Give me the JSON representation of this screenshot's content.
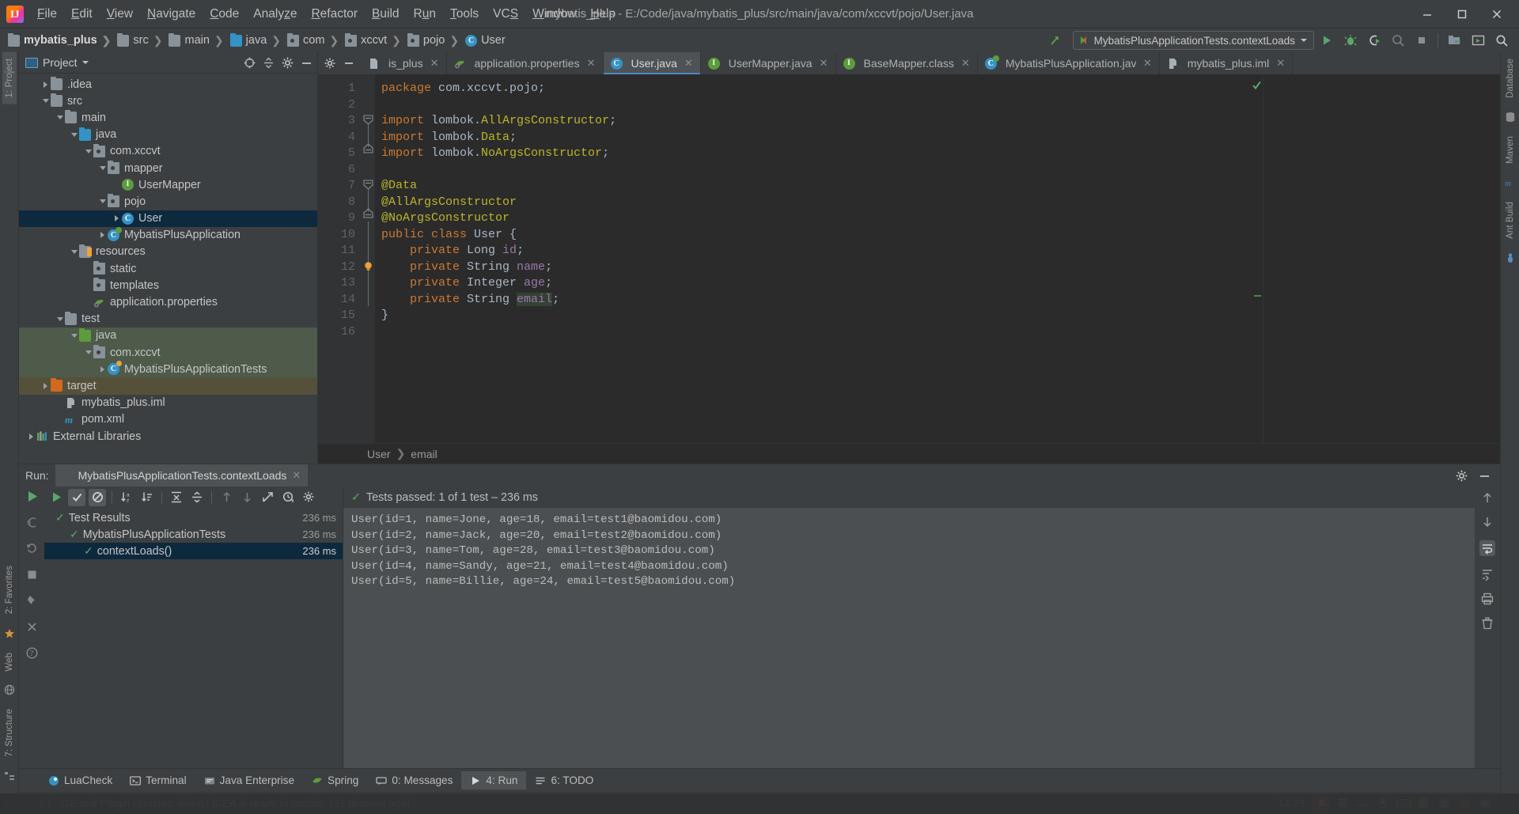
{
  "window": {
    "title": "mybatis_plus - E:/Code/java/mybatis_plus/src/main/java/com/xccvt/pojo/User.java",
    "app_icon": "intellij-idea-logo",
    "minimize": "minimize-icon",
    "maximize": "maximize-icon",
    "close": "close-icon"
  },
  "menubar": {
    "items": [
      {
        "label": "File"
      },
      {
        "label": "Edit"
      },
      {
        "label": "View"
      },
      {
        "label": "Navigate"
      },
      {
        "label": "Code"
      },
      {
        "label": "Analyze"
      },
      {
        "label": "Refactor"
      },
      {
        "label": "Build"
      },
      {
        "label": "Run"
      },
      {
        "label": "Tools"
      },
      {
        "label": "VCS"
      },
      {
        "label": "Window"
      },
      {
        "label": "Help"
      }
    ]
  },
  "navbar": {
    "breadcrumbs": [
      {
        "label": "mybatis_plus",
        "icon": "module-folder-icon"
      },
      {
        "label": "src",
        "icon": "folder-icon"
      },
      {
        "label": "main",
        "icon": "folder-icon"
      },
      {
        "label": "java",
        "icon": "source-folder-icon"
      },
      {
        "label": "com",
        "icon": "package-icon"
      },
      {
        "label": "xccvt",
        "icon": "package-icon"
      },
      {
        "label": "pojo",
        "icon": "package-icon"
      },
      {
        "label": "User",
        "icon": "class-icon"
      }
    ],
    "run_config": "MybatisPlusApplicationTests.contextLoads",
    "buttons": [
      {
        "name": "run-button",
        "icon": "play-icon"
      },
      {
        "name": "debug-button",
        "icon": "bug-icon"
      },
      {
        "name": "run-with-coverage-button",
        "icon": "coverage-icon"
      },
      {
        "name": "profile-button",
        "icon": "profiler-icon"
      },
      {
        "name": "stop-button",
        "icon": "stop-icon"
      },
      {
        "name": "project-structure-button",
        "icon": "project-structure-icon"
      },
      {
        "name": "updates-button",
        "icon": "terminal-window-icon"
      },
      {
        "name": "search-everywhere-button",
        "icon": "search-icon"
      }
    ]
  },
  "left_strip": {
    "items": [
      {
        "label": "1: Project",
        "selected": true
      },
      {
        "label": "2: Favorites",
        "selected": false
      },
      {
        "label": "Web",
        "selected": false
      },
      {
        "label": "7: Structure",
        "selected": false
      }
    ],
    "more": "»"
  },
  "right_strip": {
    "items": [
      {
        "label": "Database"
      },
      {
        "label": "Maven"
      },
      {
        "label": "Ant Build"
      }
    ]
  },
  "project_panel": {
    "title": "Project",
    "actions": [
      {
        "name": "scroll-from-source-icon"
      },
      {
        "name": "collapse-all-icon"
      },
      {
        "name": "settings-gear-icon"
      },
      {
        "name": "hide-panel-icon"
      }
    ],
    "tree": [
      {
        "label": ".idea",
        "indent": 1,
        "arrow": "right",
        "icon": "folder-icon",
        "state": "normal"
      },
      {
        "label": "src",
        "indent": 1,
        "arrow": "down",
        "icon": "folder-icon",
        "state": "normal"
      },
      {
        "label": "main",
        "indent": 2,
        "arrow": "down",
        "icon": "folder-icon",
        "state": "normal"
      },
      {
        "label": "java",
        "indent": 3,
        "arrow": "down",
        "icon": "source-folder-icon",
        "state": "normal"
      },
      {
        "label": "com.xccvt",
        "indent": 4,
        "arrow": "down",
        "icon": "package-icon",
        "state": "normal"
      },
      {
        "label": "mapper",
        "indent": 5,
        "arrow": "down",
        "icon": "package-icon",
        "state": "normal"
      },
      {
        "label": "UserMapper",
        "indent": 6,
        "arrow": "none",
        "icon": "interface-icon",
        "state": "normal"
      },
      {
        "label": "pojo",
        "indent": 5,
        "arrow": "down",
        "icon": "package-icon",
        "state": "normal"
      },
      {
        "label": "User",
        "indent": 6,
        "arrow": "right",
        "icon": "class-icon",
        "state": "selected"
      },
      {
        "label": "MybatisPlusApplication",
        "indent": 5,
        "arrow": "right",
        "icon": "spring-class-icon",
        "state": "normal"
      },
      {
        "label": "resources",
        "indent": 3,
        "arrow": "down",
        "icon": "resources-folder-icon",
        "state": "normal"
      },
      {
        "label": "static",
        "indent": 4,
        "arrow": "none",
        "icon": "package-icon",
        "state": "normal"
      },
      {
        "label": "templates",
        "indent": 4,
        "arrow": "none",
        "icon": "package-icon",
        "state": "normal"
      },
      {
        "label": "application.properties",
        "indent": 4,
        "arrow": "none",
        "icon": "spring-properties-icon",
        "state": "normal"
      },
      {
        "label": "test",
        "indent": 2,
        "arrow": "down",
        "icon": "folder-icon",
        "state": "normal"
      },
      {
        "label": "java",
        "indent": 3,
        "arrow": "down",
        "icon": "test-source-folder-icon",
        "state": "test"
      },
      {
        "label": "com.xccvt",
        "indent": 4,
        "arrow": "down",
        "icon": "package-icon",
        "state": "test"
      },
      {
        "label": "MybatisPlusApplicationTests",
        "indent": 5,
        "arrow": "right",
        "icon": "spring-test-class-icon",
        "state": "test"
      },
      {
        "label": "target",
        "indent": 1,
        "arrow": "right",
        "icon": "excluded-folder-icon",
        "state": "excluded"
      },
      {
        "label": "mybatis_plus.iml",
        "indent": 2,
        "arrow": "none",
        "icon": "iml-file-icon",
        "state": "normal"
      },
      {
        "label": "pom.xml",
        "indent": 2,
        "arrow": "none",
        "icon": "maven-file-icon",
        "state": "normal"
      },
      {
        "label": "External Libraries",
        "indent": 0,
        "arrow": "right",
        "icon": "libraries-icon",
        "state": "normal"
      }
    ]
  },
  "editor": {
    "tabs": [
      {
        "label": "is_plus",
        "icon": "file-icon",
        "active": false,
        "clipped": true
      },
      {
        "label": "application.properties",
        "icon": "spring-properties-icon",
        "active": false,
        "clipped": false
      },
      {
        "label": "User.java",
        "icon": "class-icon",
        "active": true,
        "clipped": false
      },
      {
        "label": "UserMapper.java",
        "icon": "interface-icon",
        "active": false,
        "clipped": false
      },
      {
        "label": "BaseMapper.class",
        "icon": "interface-icon",
        "active": false,
        "clipped": false
      },
      {
        "label": "MybatisPlusApplication.java",
        "icon": "spring-class-icon",
        "active": false,
        "clipped": false
      },
      {
        "label": "mybatis_plus.iml",
        "icon": "iml-file-icon",
        "active": false,
        "clipped": false
      }
    ],
    "tab_actions": [
      {
        "name": "settings-gear-icon"
      },
      {
        "name": "hide-editor-icon"
      }
    ],
    "line_numbers": [
      "1",
      "2",
      "3",
      "4",
      "5",
      "6",
      "7",
      "8",
      "9",
      "10",
      "11",
      "12",
      "13",
      "14",
      "15",
      "16"
    ],
    "lines": [
      {
        "n": 1,
        "tokens": [
          {
            "t": "package ",
            "c": "k"
          },
          {
            "t": "com.xccvt.pojo;",
            "c": "p"
          }
        ]
      },
      {
        "n": 2,
        "tokens": []
      },
      {
        "n": 3,
        "tokens": [
          {
            "t": "import ",
            "c": "k"
          },
          {
            "t": "lombok.",
            "c": "p"
          },
          {
            "t": "AllArgsConstructor",
            "c": "an"
          },
          {
            "t": ";",
            "c": "p"
          }
        ]
      },
      {
        "n": 4,
        "tokens": [
          {
            "t": "import ",
            "c": "k"
          },
          {
            "t": "lombok.",
            "c": "p"
          },
          {
            "t": "Data",
            "c": "an"
          },
          {
            "t": ";",
            "c": "p"
          }
        ]
      },
      {
        "n": 5,
        "tokens": [
          {
            "t": "import ",
            "c": "k"
          },
          {
            "t": "lombok.",
            "c": "p"
          },
          {
            "t": "NoArgsConstructor",
            "c": "an"
          },
          {
            "t": ";",
            "c": "p"
          }
        ]
      },
      {
        "n": 6,
        "tokens": []
      },
      {
        "n": 7,
        "tokens": [
          {
            "t": "@Data",
            "c": "an"
          }
        ]
      },
      {
        "n": 8,
        "tokens": [
          {
            "t": "@AllArgsConstructor",
            "c": "an"
          }
        ]
      },
      {
        "n": 9,
        "tokens": [
          {
            "t": "@NoArgsConstructor",
            "c": "an"
          }
        ]
      },
      {
        "n": 10,
        "tokens": [
          {
            "t": "public class ",
            "c": "k"
          },
          {
            "t": "User ",
            "c": "p"
          },
          {
            "t": "{",
            "c": "p"
          }
        ]
      },
      {
        "n": 11,
        "tokens": [
          {
            "t": "    ",
            "c": "p"
          },
          {
            "t": "private ",
            "c": "k"
          },
          {
            "t": "Long ",
            "c": "p"
          },
          {
            "t": "id",
            "c": "fld"
          },
          {
            "t": ";",
            "c": "p"
          }
        ]
      },
      {
        "n": 12,
        "tokens": [
          {
            "t": "    ",
            "c": "p"
          },
          {
            "t": "private ",
            "c": "k"
          },
          {
            "t": "String ",
            "c": "p"
          },
          {
            "t": "name",
            "c": "fld"
          },
          {
            "t": ";",
            "c": "p"
          }
        ]
      },
      {
        "n": 13,
        "tokens": [
          {
            "t": "    ",
            "c": "p"
          },
          {
            "t": "private ",
            "c": "k"
          },
          {
            "t": "Integer ",
            "c": "p"
          },
          {
            "t": "age",
            "c": "fld"
          },
          {
            "t": ";",
            "c": "p"
          }
        ]
      },
      {
        "n": 14,
        "tokens": [
          {
            "t": "    ",
            "c": "p"
          },
          {
            "t": "private ",
            "c": "k"
          },
          {
            "t": "String ",
            "c": "p"
          },
          {
            "t": "email",
            "c": "fld-hl"
          },
          {
            "t": ";",
            "c": "p"
          }
        ]
      },
      {
        "n": 15,
        "tokens": [
          {
            "t": "}",
            "c": "p"
          }
        ]
      },
      {
        "n": 16,
        "tokens": []
      }
    ],
    "intention_bulb_line": 13,
    "breadcrumb": [
      {
        "label": "User"
      },
      {
        "label": "email"
      }
    ],
    "inspection_status": "no-errors-checkmark"
  },
  "run_panel": {
    "label": "Run:",
    "tab_title": "MybatisPlusApplicationTests.contextLoads",
    "header_actions": [
      {
        "name": "settings-gear-icon"
      },
      {
        "name": "hide-panel-icon"
      }
    ],
    "toolbar": [
      {
        "name": "rerun-button",
        "icon": "play-icon",
        "state": "normal"
      },
      {
        "name": "show-passed-toggle",
        "icon": "checkmark-icon",
        "state": "on"
      },
      {
        "name": "show-ignored-toggle",
        "icon": "ignored-icon",
        "state": "on"
      },
      {
        "name": "sort-alphabetically",
        "icon": "sort-alpha-icon",
        "state": "normal"
      },
      {
        "name": "sort-by-duration",
        "icon": "sort-duration-icon",
        "state": "normal"
      },
      {
        "name": "expand-all",
        "icon": "expand-all-icon",
        "state": "normal"
      },
      {
        "name": "collapse-all",
        "icon": "collapse-all-icon",
        "state": "normal"
      },
      {
        "name": "previous-failed-test",
        "icon": "arrow-up-icon",
        "state": "dim"
      },
      {
        "name": "next-failed-test",
        "icon": "arrow-down-icon",
        "state": "dim"
      },
      {
        "name": "export-test-results",
        "icon": "export-icon",
        "state": "normal"
      },
      {
        "name": "test-history",
        "icon": "history-clock-icon",
        "state": "normal"
      },
      {
        "name": "test-settings",
        "icon": "settings-gear-icon",
        "state": "normal"
      }
    ],
    "side_icons": [
      {
        "name": "rerun-tests-icon"
      },
      {
        "name": "debug-icon"
      },
      {
        "name": "rerun-failed-icon"
      },
      {
        "name": "stop-icon"
      },
      {
        "name": "pin-tab-icon"
      },
      {
        "name": "close-tab-icon"
      },
      {
        "name": "help-icon"
      }
    ],
    "tree": [
      {
        "label": "Test Results",
        "indent": 0,
        "arrow": "down",
        "duration": "236 ms",
        "selected": false
      },
      {
        "label": "MybatisPlusApplicationTests",
        "indent": 1,
        "arrow": "down",
        "duration": "236 ms",
        "selected": false
      },
      {
        "label": "contextLoads()",
        "indent": 2,
        "arrow": "none",
        "duration": "236 ms",
        "selected": true
      }
    ],
    "status": "Tests passed: 1 of 1 test – 236 ms",
    "console": [
      "User(id=1, name=Jone, age=18, email=test1@baomidou.com)",
      "User(id=2, name=Jack, age=20, email=test2@baomidou.com)",
      "User(id=3, name=Tom, age=28, email=test3@baomidou.com)",
      "User(id=4, name=Sandy, age=21, email=test4@baomidou.com)",
      "User(id=5, name=Billie, age=24, email=test5@baomidou.com)"
    ],
    "console_right_icons": [
      {
        "name": "scroll-up-icon"
      },
      {
        "name": "scroll-down-icon"
      },
      {
        "name": "soft-wrap-icon"
      },
      {
        "name": "scroll-to-end-icon"
      },
      {
        "name": "print-icon"
      },
      {
        "name": "clear-all-icon"
      }
    ]
  },
  "status_bar": {
    "tabs": [
      {
        "label": "LuaCheck",
        "icon": "luacheck-icon",
        "active": false
      },
      {
        "label": "Terminal",
        "icon": "terminal-icon",
        "active": false
      },
      {
        "label": "Java Enterprise",
        "icon": "java-enterprise-icon",
        "active": false
      },
      {
        "label": "Spring",
        "icon": "spring-icon",
        "active": false
      },
      {
        "label": "0: Messages",
        "icon": "messages-icon",
        "active": false
      },
      {
        "label": "4: Run",
        "icon": "run-icon",
        "active": true
      },
      {
        "label": "6: TODO",
        "icon": "todo-icon",
        "active": false
      }
    ],
    "message": "IDE and Plugin Updates: IntelliJ IDEA is ready to update. (21 minutes ago)",
    "clock": "14:23",
    "tray": [
      {
        "name": "sogou-ime-icon",
        "label": "S"
      },
      {
        "name": "ime-lang-icon",
        "label": "英"
      },
      {
        "name": "ime-tools-icon",
        "label": "\\u2026"
      },
      {
        "name": "microphone-icon",
        "label": ""
      },
      {
        "name": "keyboard-icon",
        "label": ""
      },
      {
        "name": "clipboard-icon",
        "label": ""
      },
      {
        "name": "emoji-icon",
        "label": ""
      },
      {
        "name": "toolbox-icon",
        "label": ""
      },
      {
        "name": "skin-icon",
        "label": ""
      }
    ]
  },
  "colors": {
    "chrome": "#3c3f41",
    "editor_bg": "#2b2b2b",
    "gutter_bg": "#313335",
    "selection": "#0d293e",
    "test_root": "#4e5a4a",
    "excluded": "#55503a",
    "accent_blue": "#3592c4",
    "green": "#59a869",
    "keyword_orange": "#cc7832",
    "annotation_yellow": "#bbb529",
    "field_purple": "#9876aa",
    "console_bg": "#4b4f51"
  }
}
